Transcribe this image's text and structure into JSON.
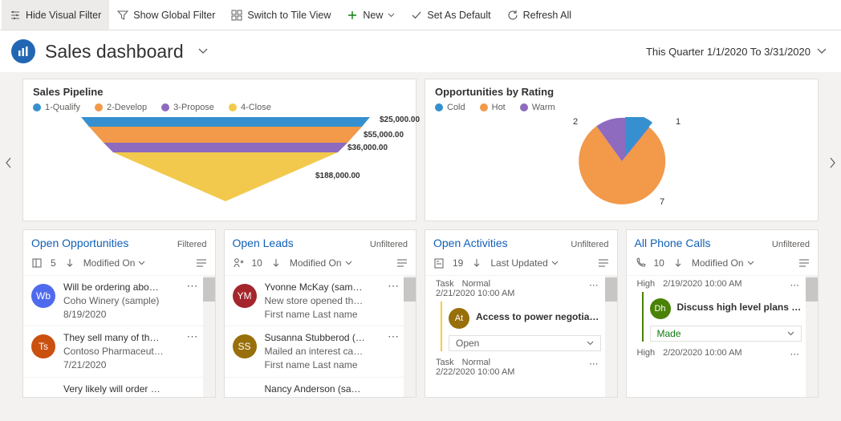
{
  "toolbar": {
    "hide_visual_filter": "Hide Visual Filter",
    "show_global_filter": "Show Global Filter",
    "switch_tile_view": "Switch to Tile View",
    "new": "New",
    "set_default": "Set As Default",
    "refresh_all": "Refresh All"
  },
  "header": {
    "title": "Sales dashboard",
    "date_range": "This Quarter 1/1/2020 To 3/31/2020"
  },
  "charts": {
    "pipeline": {
      "title": "Sales Pipeline",
      "legend": [
        "1-Qualify",
        "2-Develop",
        "3-Propose",
        "4-Close"
      ]
    },
    "rating": {
      "title": "Opportunities by Rating",
      "legend": [
        "Cold",
        "Hot",
        "Warm"
      ]
    }
  },
  "chart_data": [
    {
      "type": "funnel",
      "title": "Sales Pipeline",
      "series": [
        {
          "name": "1-Qualify",
          "value": 25000.0,
          "label": "$25,000.00",
          "color": "#3690cf"
        },
        {
          "name": "2-Develop",
          "value": 55000.0,
          "label": "$55,000.00",
          "color": "#f2994a"
        },
        {
          "name": "3-Propose",
          "value": 36000.0,
          "label": "$36,000.00",
          "color": "#8e6bbf"
        },
        {
          "name": "4-Close",
          "value": 188000.0,
          "label": "$188,000.00",
          "color": "#f2c94c"
        }
      ]
    },
    {
      "type": "pie",
      "title": "Opportunities by Rating",
      "series": [
        {
          "name": "Cold",
          "value": 1,
          "color": "#3690cf"
        },
        {
          "name": "Hot",
          "value": 7,
          "color": "#f2994a"
        },
        {
          "name": "Warm",
          "value": 2,
          "color": "#8e6bbf"
        }
      ]
    }
  ],
  "cards": {
    "opportunities": {
      "title": "Open Opportunities",
      "filter": "Filtered",
      "count": "5",
      "sort": "Modified On",
      "items": [
        {
          "avatar": "Wb",
          "avatar_color": "#4f6bed",
          "line1": "Will be ordering abo…",
          "line2": "Coho Winery (sample)",
          "line3": "8/19/2020"
        },
        {
          "avatar": "Ts",
          "avatar_color": "#ca5010",
          "line1": "They sell many of th…",
          "line2": "Contoso Pharmaceut…",
          "line3": "7/21/2020"
        },
        {
          "avatar": "",
          "avatar_color": "#3690cf",
          "line1": "Very likely will order …",
          "line2": "",
          "line3": ""
        }
      ]
    },
    "leads": {
      "title": "Open Leads",
      "filter": "Unfiltered",
      "count": "10",
      "sort": "Modified On",
      "items": [
        {
          "avatar": "YM",
          "avatar_color": "#a4262c",
          "line1": "Yvonne McKay (sam…",
          "line2": "New store opened th…",
          "line3": "First name Last name"
        },
        {
          "avatar": "SS",
          "avatar_color": "#986f0b",
          "line1": "Susanna Stubberod (…",
          "line2": "Mailed an interest ca…",
          "line3": "First name Last name"
        },
        {
          "avatar": "",
          "avatar_color": "#8764b8",
          "line1": "Nancy Anderson (sa…",
          "line2": "",
          "line3": ""
        }
      ]
    },
    "activities": {
      "title": "Open Activities",
      "filter": "Unfiltered",
      "count": "19",
      "sort": "Last Updated",
      "items": [
        {
          "type": "Task",
          "priority": "Normal",
          "timestamp": "2/21/2020 10:00 AM",
          "avatar": "At",
          "avatar_color": "#986f0b",
          "subject": "Access to power negotiated …",
          "status": "Open"
        },
        {
          "type": "Task",
          "priority": "Normal",
          "timestamp": "2/22/2020 10:00 AM"
        }
      ]
    },
    "phonecalls": {
      "title": "All Phone Calls",
      "filter": "Unfiltered",
      "count": "10",
      "sort": "Modified On",
      "items": [
        {
          "priority": "High",
          "timestamp": "2/19/2020 10:00 AM",
          "avatar": "Dh",
          "avatar_color": "#498205",
          "subject": "Discuss high level plans for f…",
          "status": "Made"
        },
        {
          "priority": "High",
          "timestamp": "2/20/2020 10:00 AM"
        }
      ]
    }
  },
  "colors": {
    "qualify": "#3690cf",
    "develop": "#f2994a",
    "propose": "#8e6bbf",
    "close": "#f2c94c",
    "cold": "#3690cf",
    "hot": "#f2994a",
    "warm": "#8e6bbf"
  }
}
